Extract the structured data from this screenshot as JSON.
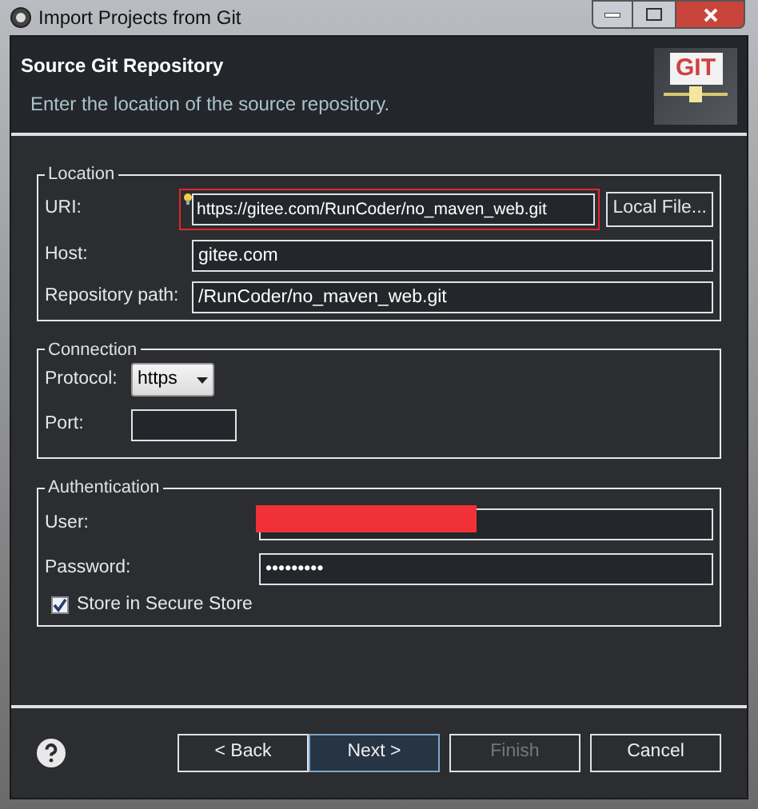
{
  "window": {
    "title": "Import Projects from Git"
  },
  "header": {
    "title": "Source Git Repository",
    "description": "Enter the location of the source repository.",
    "logo_text": "GIT"
  },
  "location": {
    "title": "Location",
    "uri": {
      "label": "URI:",
      "value": "https://gitee.com/RunCoder/no_maven_web.git",
      "highlighted": true
    },
    "local_file_button": "Local File...",
    "host": {
      "label": "Host:",
      "value": "gitee.com"
    },
    "repository_path": {
      "label": "Repository path:",
      "value": "/RunCoder/no_maven_web.git"
    }
  },
  "connection": {
    "title": "Connection",
    "protocol": {
      "label": "Protocol:",
      "value": "https"
    },
    "port": {
      "label": "Port:"
    }
  },
  "authentication": {
    "title": "Authentication",
    "user": {
      "label": "User:",
      "redacted": true
    },
    "password": {
      "label": "Password:",
      "value": "•••••••••"
    },
    "store": {
      "label": "Store in Secure Store",
      "checked": true
    }
  },
  "buttons": [
    {
      "label": "< Back",
      "disabled": false,
      "default": false
    },
    {
      "label": "Next >",
      "disabled": false,
      "default": true
    },
    {
      "label": "Finish",
      "disabled": true,
      "default": false
    },
    {
      "label": "Cancel",
      "disabled": false,
      "default": false
    }
  ]
}
